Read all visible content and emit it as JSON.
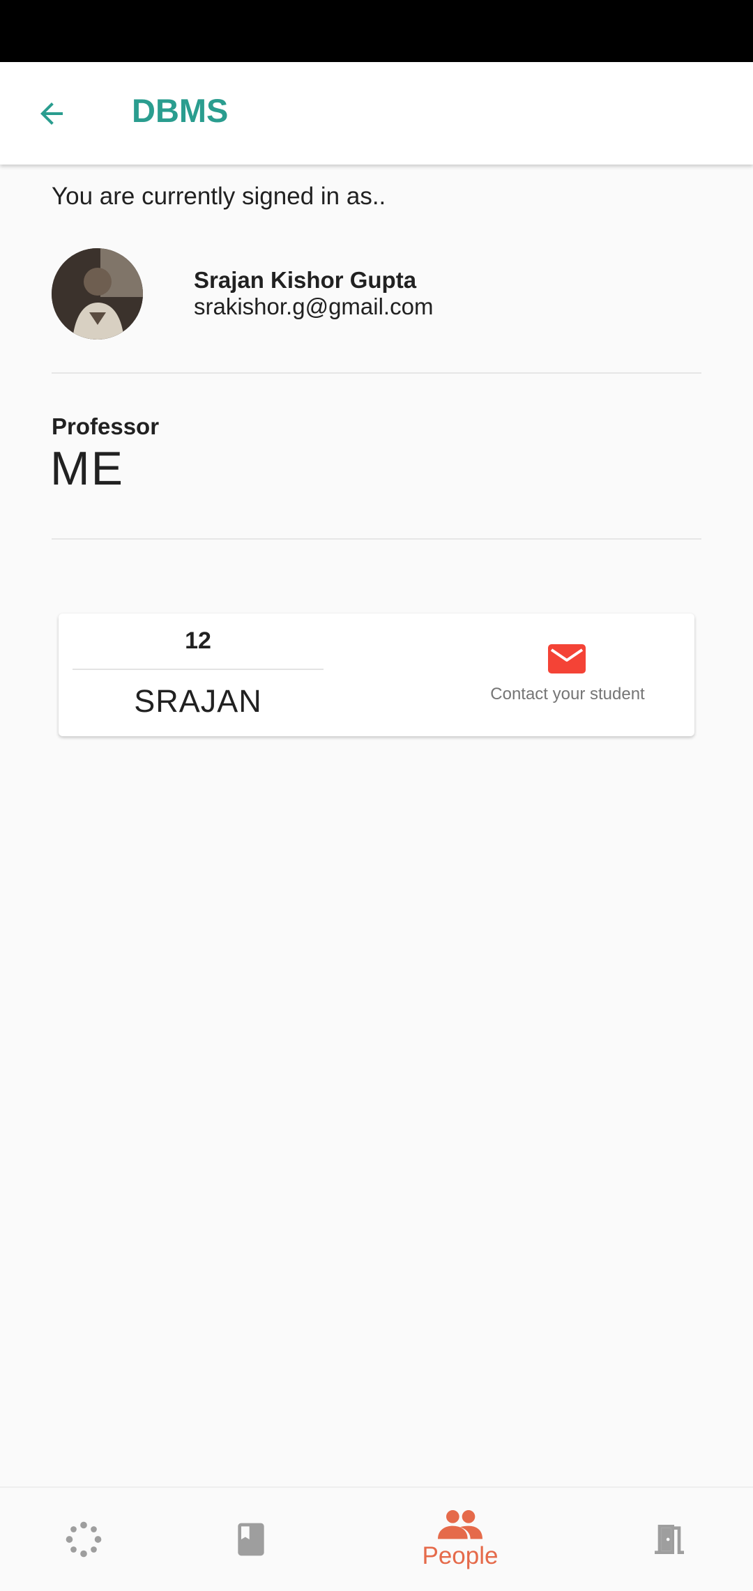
{
  "header": {
    "title": "DBMS",
    "back_icon": "arrow-back-icon"
  },
  "account": {
    "signed_in_label": "You are currently signed in as..",
    "name": "Srajan Kishor Gupta",
    "email": "srakishor.g@gmail.com"
  },
  "role": {
    "label": "Professor",
    "value": "ME"
  },
  "student_card": {
    "roll_number": "12",
    "student_name": "SRAJAN",
    "contact_label": "Contact your student",
    "contact_icon": "mail-icon"
  },
  "bottom_nav": {
    "items": [
      {
        "icon": "loading-spinner-icon",
        "label": ""
      },
      {
        "icon": "book-icon",
        "label": ""
      },
      {
        "icon": "people-icon",
        "label": "People",
        "active": true
      },
      {
        "icon": "exit-door-icon",
        "label": ""
      }
    ]
  },
  "colors": {
    "accent": "#2a9d8f",
    "active_nav": "#e56a4a",
    "mail": "#f44336",
    "inactive_icon": "#9e9e9e"
  }
}
